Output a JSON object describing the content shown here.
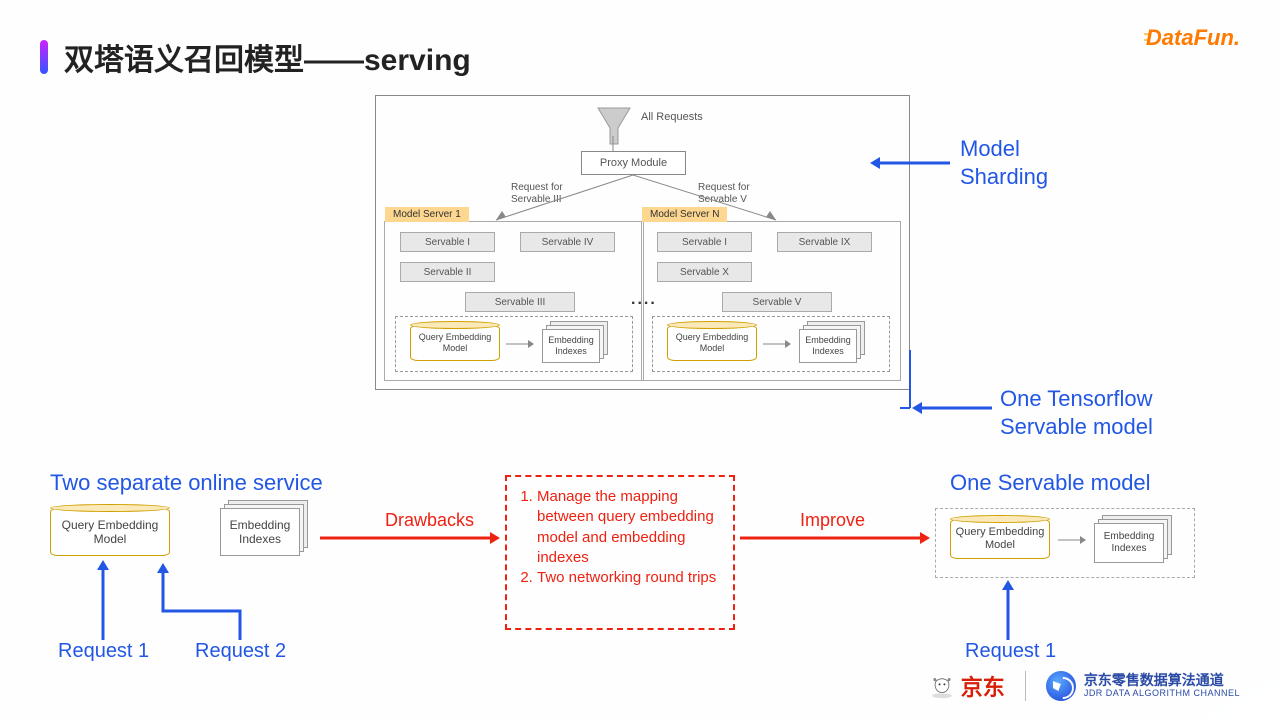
{
  "title": "双塔语义召回模型——serving",
  "logo": {
    "brand": "DataFun."
  },
  "arch": {
    "all_requests": "All Requests",
    "proxy": "Proxy Module",
    "req_left": "Request for\nServable III",
    "req_right": "Request for\nServable V",
    "server1": {
      "title": "Model Server 1",
      "s1": "Servable I",
      "s2": "Servable IV",
      "s3": "Servable II",
      "s4": "Servable III",
      "qem": "Query Embedding\nModel",
      "idx": "Embedding\nIndexes"
    },
    "server2": {
      "title": "Model Server N",
      "s1": "Servable I",
      "s2": "Servable IX",
      "s3": "Servable X",
      "s4": "Servable V",
      "qem": "Query Embedding\nModel",
      "idx": "Embedding\nIndexes"
    },
    "dots": "...."
  },
  "labels": {
    "model_sharding": "Model\nSharding",
    "one_tensorflow": "One Tensorflow\nServable model",
    "two_separate": "Two separate online service",
    "one_servable": "One Servable model",
    "drawbacks": "Drawbacks",
    "improve": "Improve",
    "req1": "Request 1",
    "req2": "Request 2"
  },
  "drawbacks": {
    "item1": "Manage the mapping between query embedding model and embedding indexes",
    "item2": "Two networking round trips"
  },
  "bottom": {
    "qem": "Query Embedding\nModel",
    "idx": "Embedding\nIndexes"
  },
  "footer": {
    "jd": "京东",
    "jdr_cn": "京东零售数据算法通道",
    "jdr_en": "JDR DATA ALGORITHM CHANNEL"
  }
}
